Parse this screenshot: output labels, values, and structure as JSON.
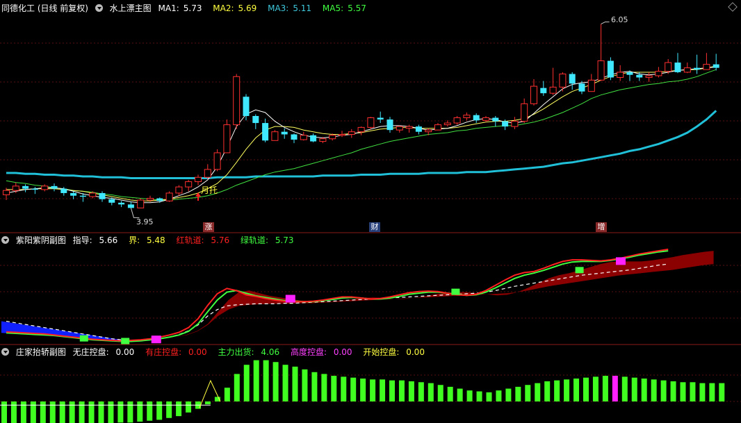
{
  "main": {
    "title": "同德化工 (日线 前复权)",
    "indicator": "水上漂主图",
    "ma1_label": "MA1:",
    "ma1_value": "5.73",
    "ma2_label": "MA2:",
    "ma2_value": "5.69",
    "ma3_label": "MA3:",
    "ma3_value": "5.11",
    "ma5_label": "MA5:",
    "ma5_value": "5.57",
    "high_label": "6.05",
    "low_label": "3.95",
    "signal_text": "月托",
    "markers": [
      {
        "text": "涨",
        "color": "#8a2a2a"
      },
      {
        "text": "财",
        "color": "#27407a"
      },
      {
        "text": "增",
        "color": "#8a2a2a"
      }
    ]
  },
  "sub1": {
    "title": "紫阳紫阴副图",
    "guide_label": "指导:",
    "guide_value": "5.66",
    "bound_label": "界:",
    "bound_value": "5.48",
    "red_label": "红轨道:",
    "red_value": "5.76",
    "green_label": "绿轨道:",
    "green_value": "5.73"
  },
  "sub2": {
    "title": "庄家抬轿副图",
    "none_label": "无庄控盘:",
    "none_value": "0.00",
    "have_label": "有庄控盘:",
    "have_value": "0.00",
    "main_label": "主力出货:",
    "main_value": "4.06",
    "high_label": "高度控盘:",
    "high_value": "0.00",
    "start_label": "开始控盘:",
    "start_value": "0.00"
  },
  "colors": {
    "up": "#ff3030",
    "down": "#40e8ff",
    "ma1": "#ffffff",
    "ma2": "#ffff60",
    "ma3": "#20c0d8",
    "ma5": "#40e040",
    "red_track": "#ff2020",
    "green_track": "#40ff40",
    "band": "#8b0000",
    "blue_band": "#1020ff",
    "bar_green": "#40ff20",
    "bar_magenta": "#ff20ff"
  },
  "chart_data": {
    "type": "candlestick",
    "candles": [
      [
        4.1,
        4.15,
        4.04,
        4.18
      ],
      [
        4.15,
        4.2,
        4.12,
        4.24
      ],
      [
        4.2,
        4.17,
        4.13,
        4.22
      ],
      [
        4.17,
        4.16,
        4.11,
        4.19
      ],
      [
        4.16,
        4.2,
        4.14,
        4.22
      ],
      [
        4.2,
        4.17,
        4.14,
        4.23
      ],
      [
        4.17,
        4.12,
        4.09,
        4.19
      ],
      [
        4.12,
        4.09,
        4.05,
        4.14
      ],
      [
        4.09,
        4.08,
        4.02,
        4.12
      ],
      [
        4.08,
        4.12,
        4.06,
        4.14
      ],
      [
        4.12,
        4.05,
        4.02,
        4.14
      ],
      [
        4.05,
        4.01,
        3.98,
        4.07
      ],
      [
        4.01,
        3.99,
        3.96,
        4.03
      ],
      [
        3.99,
        3.95,
        3.95,
        4.02
      ],
      [
        3.95,
        4.04,
        3.95,
        4.06
      ],
      [
        4.04,
        4.06,
        4.02,
        4.09
      ],
      [
        4.06,
        4.03,
        4.01,
        4.07
      ],
      [
        4.03,
        4.12,
        4.02,
        4.14
      ],
      [
        4.12,
        4.19,
        4.09,
        4.21
      ],
      [
        4.19,
        4.25,
        4.14,
        4.27
      ],
      [
        4.25,
        4.3,
        4.21,
        4.33
      ],
      [
        4.3,
        4.39,
        4.28,
        4.45
      ],
      [
        4.39,
        4.58,
        4.37,
        4.62
      ],
      [
        4.58,
        4.9,
        4.58,
        4.96
      ],
      [
        4.9,
        5.45,
        4.85,
        5.48
      ],
      [
        5.22,
        5.0,
        4.95,
        5.25
      ],
      [
        5.0,
        4.92,
        4.85,
        5.02
      ],
      [
        4.92,
        4.72,
        4.7,
        4.97
      ],
      [
        4.72,
        4.82,
        4.72,
        4.84
      ],
      [
        4.82,
        4.79,
        4.74,
        4.86
      ],
      [
        4.79,
        4.73,
        4.69,
        4.8
      ],
      [
        4.73,
        4.78,
        4.72,
        4.82
      ],
      [
        4.78,
        4.71,
        4.7,
        4.8
      ],
      [
        4.71,
        4.74,
        4.69,
        4.76
      ],
      [
        4.74,
        4.78,
        4.72,
        4.8
      ],
      [
        4.78,
        4.79,
        4.76,
        4.83
      ],
      [
        4.79,
        4.82,
        4.75,
        4.85
      ],
      [
        4.82,
        4.87,
        4.78,
        4.88
      ],
      [
        4.87,
        4.98,
        4.85,
        4.99
      ],
      [
        4.98,
        4.96,
        4.92,
        5.05
      ],
      [
        4.96,
        4.84,
        4.81,
        4.99
      ],
      [
        4.84,
        4.88,
        4.81,
        4.89
      ],
      [
        4.86,
        4.88,
        4.81,
        4.9
      ],
      [
        4.88,
        4.82,
        4.79,
        4.9
      ],
      [
        4.82,
        4.84,
        4.78,
        4.86
      ],
      [
        4.84,
        4.9,
        4.84,
        4.92
      ],
      [
        4.9,
        4.92,
        4.88,
        4.95
      ],
      [
        4.92,
        4.98,
        4.9,
        5.0
      ],
      [
        4.98,
        5.01,
        4.95,
        5.04
      ],
      [
        5.01,
        4.95,
        4.92,
        5.03
      ],
      [
        4.95,
        4.98,
        4.93,
        5.0
      ],
      [
        4.98,
        4.94,
        4.88,
        5.0
      ],
      [
        4.94,
        4.88,
        4.84,
        4.96
      ],
      [
        4.88,
        4.94,
        4.85,
        4.99
      ],
      [
        4.94,
        5.14,
        4.92,
        5.2
      ],
      [
        5.14,
        5.34,
        5.12,
        5.42
      ],
      [
        5.32,
        5.26,
        5.23,
        5.4
      ],
      [
        5.26,
        5.33,
        5.24,
        5.55
      ],
      [
        5.33,
        5.48,
        5.28,
        5.5
      ],
      [
        5.48,
        5.37,
        5.3,
        5.5
      ],
      [
        5.37,
        5.28,
        5.25,
        5.4
      ],
      [
        5.28,
        5.41,
        5.28,
        5.48
      ],
      [
        5.41,
        5.63,
        5.4,
        6.05
      ],
      [
        5.63,
        5.44,
        5.41,
        5.67
      ],
      [
        5.44,
        5.5,
        5.4,
        5.58
      ],
      [
        5.5,
        5.47,
        5.4,
        5.52
      ],
      [
        5.47,
        5.44,
        5.4,
        5.5
      ],
      [
        5.44,
        5.46,
        5.39,
        5.5
      ],
      [
        5.46,
        5.51,
        5.44,
        5.56
      ],
      [
        5.51,
        5.61,
        5.48,
        5.65
      ],
      [
        5.61,
        5.5,
        5.49,
        5.72
      ],
      [
        5.5,
        5.55,
        5.49,
        5.61
      ],
      [
        5.55,
        5.53,
        5.48,
        5.7
      ],
      [
        5.53,
        5.59,
        5.55,
        5.72
      ],
      [
        5.59,
        5.55,
        5.52,
        5.71
      ]
    ],
    "ma1": [
      4.12,
      4.14,
      4.16,
      4.17,
      4.18,
      4.18,
      4.17,
      4.14,
      4.11,
      4.09,
      4.07,
      4.06,
      4.04,
      4.02,
      4.01,
      4.01,
      4.02,
      4.05,
      4.09,
      4.13,
      4.19,
      4.27,
      4.42,
      4.64,
      4.88,
      5.02,
      5.07,
      5.04,
      4.94,
      4.87,
      4.82,
      4.78,
      4.76,
      4.75,
      4.76,
      4.78,
      4.79,
      4.82,
      4.85,
      4.88,
      4.89,
      4.89,
      4.88,
      4.86,
      4.84,
      4.85,
      4.86,
      4.89,
      4.93,
      4.96,
      4.97,
      4.96,
      4.93,
      4.92,
      4.94,
      5.03,
      5.13,
      5.22,
      5.31,
      5.36,
      5.38,
      5.39,
      5.43,
      5.47,
      5.5,
      5.51,
      5.48,
      5.47,
      5.48,
      5.5,
      5.52,
      5.53,
      5.54,
      5.55,
      5.56
    ],
    "ma2": [
      4.16,
      4.16,
      4.16,
      4.17,
      4.17,
      4.17,
      4.16,
      4.15,
      4.14,
      4.12,
      4.1,
      4.08,
      4.06,
      4.04,
      4.03,
      4.03,
      4.04,
      4.05,
      4.07,
      4.09,
      4.12,
      4.17,
      4.23,
      4.33,
      4.47,
      4.62,
      4.75,
      4.84,
      4.88,
      4.88,
      4.87,
      4.84,
      4.82,
      4.8,
      4.79,
      4.79,
      4.8,
      4.81,
      4.83,
      4.85,
      4.86,
      4.87,
      4.87,
      4.86,
      4.86,
      4.86,
      4.86,
      4.87,
      4.89,
      4.91,
      4.93,
      4.94,
      4.94,
      4.95,
      4.97,
      5.02,
      5.08,
      5.15,
      5.22,
      5.28,
      5.32,
      5.36,
      5.41,
      5.45,
      5.48,
      5.5,
      5.5,
      5.5,
      5.5,
      5.51,
      5.52,
      5.53,
      5.53,
      5.55,
      5.57
    ],
    "ma3": [
      4.35,
      4.35,
      4.34,
      4.34,
      4.33,
      4.33,
      4.32,
      4.32,
      4.31,
      4.31,
      4.3,
      4.3,
      4.3,
      4.29,
      4.29,
      4.29,
      4.29,
      4.29,
      4.29,
      4.29,
      4.29,
      4.29,
      4.3,
      4.3,
      4.3,
      4.3,
      4.31,
      4.31,
      4.31,
      4.31,
      4.31,
      4.31,
      4.31,
      4.32,
      4.32,
      4.32,
      4.32,
      4.33,
      4.33,
      4.33,
      4.34,
      4.34,
      4.34,
      4.34,
      4.35,
      4.35,
      4.35,
      4.35,
      4.36,
      4.36,
      4.36,
      4.37,
      4.38,
      4.39,
      4.4,
      4.41,
      4.42,
      4.44,
      4.46,
      4.47,
      4.49,
      4.51,
      4.53,
      4.55,
      4.57,
      4.6,
      4.62,
      4.65,
      4.68,
      4.72,
      4.76,
      4.81,
      4.88,
      4.96,
      5.06
    ],
    "ma5": [
      4.26,
      4.24,
      4.23,
      4.21,
      4.2,
      4.18,
      4.17,
      4.15,
      4.14,
      4.13,
      4.11,
      4.1,
      4.08,
      4.07,
      4.06,
      4.05,
      4.04,
      4.04,
      4.05,
      4.06,
      4.07,
      4.09,
      4.12,
      4.16,
      4.21,
      4.25,
      4.29,
      4.33,
      4.36,
      4.38,
      4.4,
      4.43,
      4.46,
      4.49,
      4.52,
      4.55,
      4.58,
      4.62,
      4.65,
      4.68,
      4.71,
      4.73,
      4.75,
      4.77,
      4.79,
      4.8,
      4.81,
      4.83,
      4.84,
      4.86,
      4.87,
      4.88,
      4.89,
      4.89,
      4.91,
      4.93,
      4.96,
      5.0,
      5.04,
      5.09,
      5.14,
      5.2,
      5.24,
      5.27,
      5.3,
      5.32,
      5.34,
      5.36,
      5.37,
      5.39,
      5.4,
      5.42,
      5.45,
      5.49,
      5.53
    ],
    "sub1": {
      "red_track": [
        4.2,
        4.19,
        4.18,
        4.17,
        4.16,
        4.14,
        4.12,
        4.1,
        4.08,
        4.06,
        4.05,
        4.04,
        4.03,
        4.04,
        4.05,
        4.07,
        4.1,
        4.14,
        4.19,
        4.28,
        4.45,
        4.7,
        4.92,
        5.02,
        4.98,
        4.9,
        4.87,
        4.83,
        4.8,
        4.78,
        4.77,
        4.77,
        4.78,
        4.8,
        4.83,
        4.86,
        4.86,
        4.84,
        4.82,
        4.83,
        4.86,
        4.9,
        4.94,
        4.96,
        4.97,
        4.96,
        4.93,
        4.9,
        4.89,
        4.91,
        4.98,
        5.08,
        5.18,
        5.27,
        5.32,
        5.34,
        5.4,
        5.47,
        5.53,
        5.56,
        5.56,
        5.55,
        5.54,
        5.56,
        5.59,
        5.63,
        5.67,
        5.7,
        5.73,
        5.76
      ],
      "green_track": [
        4.18,
        4.17,
        4.16,
        4.15,
        4.14,
        4.13,
        4.11,
        4.09,
        4.07,
        4.05,
        4.04,
        4.03,
        4.02,
        4.02,
        4.03,
        4.05,
        4.07,
        4.1,
        4.14,
        4.21,
        4.35,
        4.58,
        4.8,
        4.95,
        4.98,
        4.93,
        4.88,
        4.85,
        4.82,
        4.79,
        4.78,
        4.77,
        4.77,
        4.79,
        4.81,
        4.84,
        4.85,
        4.84,
        4.82,
        4.82,
        4.84,
        4.87,
        4.91,
        4.93,
        4.95,
        4.95,
        4.93,
        4.91,
        4.89,
        4.9,
        4.95,
        5.03,
        5.12,
        5.21,
        5.27,
        5.31,
        5.36,
        5.42,
        5.48,
        5.52,
        5.53,
        5.53,
        5.53,
        5.55,
        5.58,
        5.61,
        5.65,
        5.68,
        5.71,
        5.73
      ],
      "bound": [
        4.4,
        4.37,
        4.34,
        4.31,
        4.28,
        4.25,
        4.22,
        4.19,
        4.16,
        4.13,
        4.1,
        4.07,
        4.05,
        4.04,
        4.04,
        4.05,
        4.07,
        4.1,
        4.15,
        4.22,
        4.33,
        4.5,
        4.62,
        4.69,
        4.71,
        4.72,
        4.73,
        4.73,
        4.73,
        4.74,
        4.74,
        4.75,
        4.76,
        4.77,
        4.78,
        4.79,
        4.8,
        4.81,
        4.82,
        4.83,
        4.84,
        4.85,
        4.86,
        4.87,
        4.88,
        4.89,
        4.9,
        4.91,
        4.92,
        4.93,
        4.95,
        4.98,
        5.02,
        5.06,
        5.09,
        5.12,
        5.15,
        5.18,
        5.21,
        5.24,
        5.27,
        5.29,
        5.31,
        5.33,
        5.35,
        5.37,
        5.4,
        5.43,
        5.46,
        5.48
      ],
      "green_marks": [
        8,
        12,
        44,
        56
      ],
      "magenta_marks": [
        15,
        28,
        60
      ]
    },
    "sub2": {
      "green_bars": [
        -2.8,
        -2.8,
        -2.8,
        -2.7,
        -2.7,
        -2.7,
        -2.6,
        -2.6,
        -2.5,
        -2.5,
        -2.4,
        -2.4,
        -2.3,
        -2.3,
        -2.2,
        -2.1,
        -2.0,
        -1.8,
        -1.6,
        -1.2,
        -0.8,
        -0.3,
        0.5,
        1.5,
        3.0,
        4.0,
        4.5,
        4.5,
        4.3,
        4.0,
        3.8,
        3.5,
        3.2,
        3.0,
        2.8,
        2.7,
        2.6,
        2.5,
        2.4,
        2.4,
        2.3,
        2.3,
        2.2,
        2.1,
        2.0,
        1.8,
        1.6,
        1.4,
        1.2,
        1.1,
        1.0,
        1.2,
        1.4,
        1.6,
        1.8,
        2.0,
        2.2,
        2.3,
        2.4,
        2.5,
        2.6,
        2.7,
        2.8,
        2.8,
        2.7,
        2.6,
        2.5,
        2.4,
        2.3,
        2.2,
        2.1,
        2.1,
        2.0,
        2.0,
        2.0
      ],
      "magenta_bar_index": 63,
      "white_line": -0.4,
      "yellow_peak_index": 22
    }
  }
}
